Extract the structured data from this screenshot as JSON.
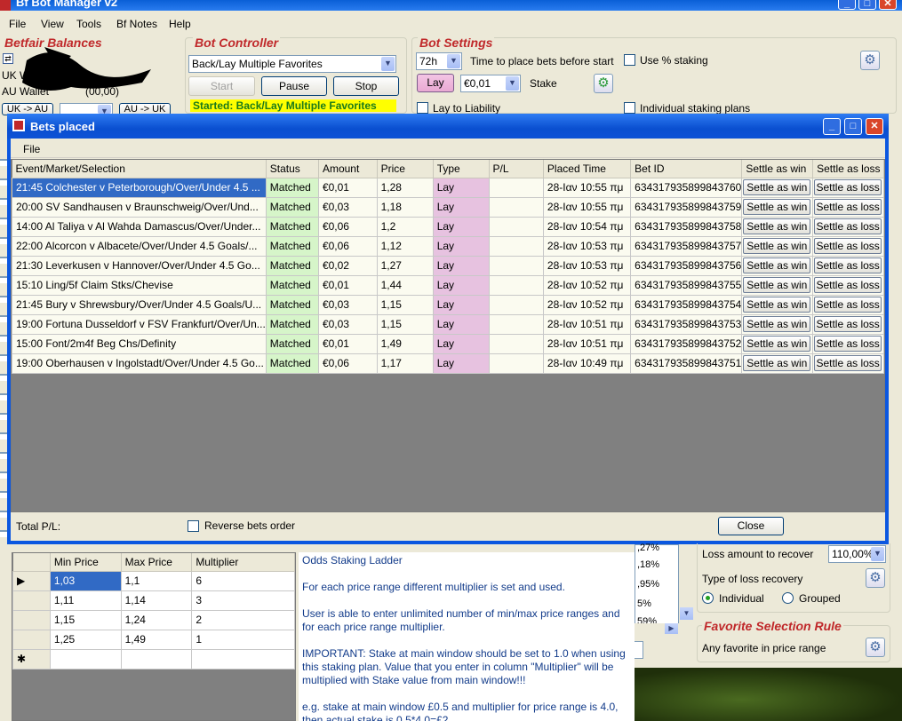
{
  "main_window": {
    "title": "Bf Bot Manager v2",
    "menu": [
      "File",
      "View",
      "Tools",
      "Bf Notes",
      "Help"
    ]
  },
  "balances": {
    "title": "Betfair Balances",
    "uk_label": "UK W",
    "au_label": "AU Wallet",
    "au_amount_partial": "(00,00)",
    "uk_to_au_button": "UK -> AU",
    "au_to_uk_button": "AU -> UK"
  },
  "bot_controller": {
    "title": "Bot Controller",
    "strategy": "Back/Lay Multiple Favorites",
    "start_button": "Start",
    "pause_button": "Pause",
    "stop_button": "Stop",
    "status": "Started: Back/Lay Multiple Favorites"
  },
  "bot_settings": {
    "title": "Bot Settings",
    "time_value": "72h",
    "time_label": "Time to place bets before start",
    "use_percent_label": "Use % staking",
    "lay_button": "Lay",
    "stake_value": "€0,01",
    "stake_label": "Stake",
    "lay_to_liability_label": "Lay to Liability",
    "individual_staking_label": "Individual staking plans"
  },
  "bets_window": {
    "title": "Bets placed",
    "menu_file": "File",
    "columns": [
      "Event/Market/Selection",
      "Status",
      "Amount",
      "Price",
      "Type",
      "P/L",
      "Placed Time",
      "Bet ID",
      "Settle as win",
      "Settle as loss"
    ],
    "rows": [
      {
        "event": "21:45 Colchester v Peterborough/Over/Under 4.5 ...",
        "status": "Matched",
        "amount": "€0,01",
        "price": "1,28",
        "type": "Lay",
        "pl": "",
        "time": "28-Ιαν 10:55 πμ",
        "bet_id": "634317935899843760"
      },
      {
        "event": "20:00 SV Sandhausen v Braunschweig/Over/Und...",
        "status": "Matched",
        "amount": "€0,03",
        "price": "1,18",
        "type": "Lay",
        "pl": "",
        "time": "28-Ιαν 10:55 πμ",
        "bet_id": "634317935899843759"
      },
      {
        "event": "14:00 Al Taliya v Al Wahda Damascus/Over/Under...",
        "status": "Matched",
        "amount": "€0,06",
        "price": "1,2",
        "type": "Lay",
        "pl": "",
        "time": "28-Ιαν 10:54 πμ",
        "bet_id": "634317935899843758"
      },
      {
        "event": "22:00 Alcorcon v Albacete/Over/Under 4.5 Goals/...",
        "status": "Matched",
        "amount": "€0,06",
        "price": "1,12",
        "type": "Lay",
        "pl": "",
        "time": "28-Ιαν 10:53 πμ",
        "bet_id": "634317935899843757"
      },
      {
        "event": "21:30 Leverkusen v Hannover/Over/Under 4.5 Go...",
        "status": "Matched",
        "amount": "€0,02",
        "price": "1,27",
        "type": "Lay",
        "pl": "",
        "time": "28-Ιαν 10:53 πμ",
        "bet_id": "634317935899843756"
      },
      {
        "event": "15:10 Ling/5f Claim Stks/Chevise",
        "status": "Matched",
        "amount": "€0,01",
        "price": "1,44",
        "type": "Lay",
        "pl": "",
        "time": "28-Ιαν 10:52 πμ",
        "bet_id": "634317935899843755"
      },
      {
        "event": "21:45 Bury v Shrewsbury/Over/Under 4.5 Goals/U...",
        "status": "Matched",
        "amount": "€0,03",
        "price": "1,15",
        "type": "Lay",
        "pl": "",
        "time": "28-Ιαν 10:52 πμ",
        "bet_id": "634317935899843754"
      },
      {
        "event": "19:00 Fortuna Dusseldorf v FSV Frankfurt/Over/Un...",
        "status": "Matched",
        "amount": "€0,03",
        "price": "1,15",
        "type": "Lay",
        "pl": "",
        "time": "28-Ιαν 10:51 πμ",
        "bet_id": "634317935899843753"
      },
      {
        "event": "15:00 Font/2m4f Beg Chs/Definity",
        "status": "Matched",
        "amount": "€0,01",
        "price": "1,49",
        "type": "Lay",
        "pl": "",
        "time": "28-Ιαν 10:51 πμ",
        "bet_id": "634317935899843752"
      },
      {
        "event": "19:00 Oberhausen v Ingolstadt/Over/Under 4.5 Go...",
        "status": "Matched",
        "amount": "€0,06",
        "price": "1,17",
        "type": "Lay",
        "pl": "",
        "time": "28-Ιαν 10:49 πμ",
        "bet_id": "634317935899843751"
      }
    ],
    "settle_win_label": "Settle as win",
    "settle_loss_label": "Settle as loss",
    "total_pl_label": "Total P/L:",
    "reverse_label": "Reverse bets order",
    "close_button": "Close"
  },
  "ladder": {
    "columns": [
      "Min Price",
      "Max Price",
      "Multiplier"
    ],
    "rows": [
      {
        "marker": "▶",
        "min": "1,03",
        "max": "1,1",
        "mult": "6"
      },
      {
        "marker": "",
        "min": "1,11",
        "max": "1,14",
        "mult": "3"
      },
      {
        "marker": "",
        "min": "1,15",
        "max": "1,24",
        "mult": "2"
      },
      {
        "marker": "",
        "min": "1,25",
        "max": "1,49",
        "mult": "1"
      },
      {
        "marker": "✱",
        "min": "",
        "max": "",
        "mult": ""
      }
    ],
    "info_title": "Odds Staking Ladder",
    "info_p1": "For each price range different multiplier is set and used.",
    "info_p2": "User is able to enter unlimited number of min/max price ranges and for each price range multiplier.",
    "info_p3": "IMPORTANT: Stake at main window should be set to 1.0 when using this staking plan. Value that you enter in column \"Multiplier\" will be multiplied with Stake value from main window!!!",
    "info_p4": "e.g. stake at main window £0.5 and multiplier for price range is 4.0, then actual stake is 0.5*4.0=£2"
  },
  "recovery": {
    "partial_values": [
      ",27%",
      ",18%",
      ",95%",
      "5%",
      "59%"
    ],
    "loss_amount_label": "Loss amount to recover",
    "loss_amount_value": "110,00%",
    "type_label": "Type of loss recovery",
    "individual_label": "Individual",
    "grouped_label": "Grouped"
  },
  "favorite_rule": {
    "title": "Favorite Selection Rule",
    "rule": "Any favorite in price range"
  }
}
